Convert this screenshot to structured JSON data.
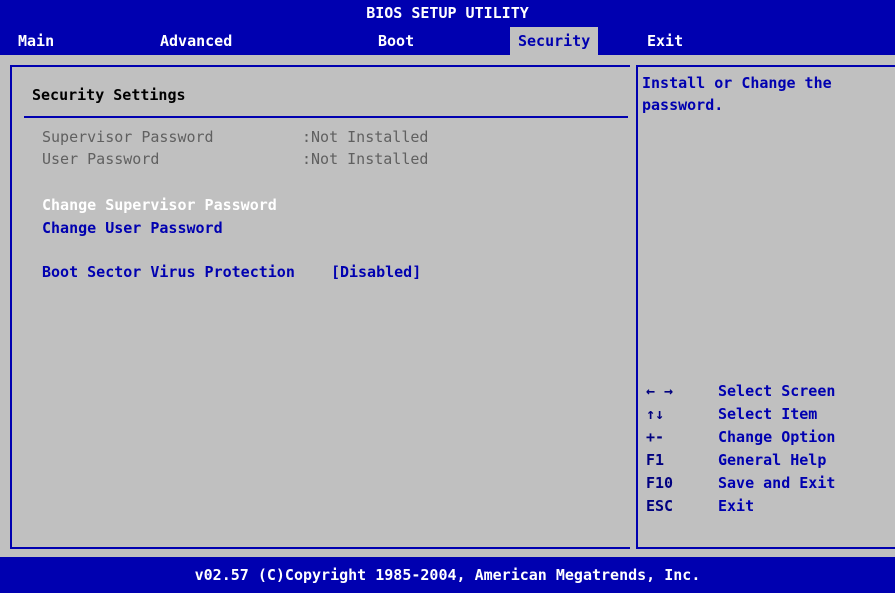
{
  "title": "BIOS SETUP UTILITY",
  "menu": {
    "main": "Main",
    "advanced": "Advanced",
    "boot": "Boot",
    "security": "Security",
    "exit": "Exit"
  },
  "section_title": "Security Settings",
  "info": [
    {
      "label": "Supervisor Password",
      "value": ":Not Installed"
    },
    {
      "label": "User Password",
      "value": ":Not Installed"
    }
  ],
  "items": {
    "change_supervisor": "Change Supervisor Password",
    "change_user": "Change User Password",
    "boot_sector_label": "Boot Sector Virus Protection",
    "boot_sector_value": "[Disabled]"
  },
  "help_text": "Install or Change the password.",
  "keys": [
    {
      "key": "← →",
      "desc": "Select Screen"
    },
    {
      "key": "↑↓",
      "desc": "Select Item"
    },
    {
      "key": "+-",
      "desc": "Change Option"
    },
    {
      "key": "F1",
      "desc": "General Help"
    },
    {
      "key": "F10",
      "desc": "Save and Exit"
    },
    {
      "key": "ESC",
      "desc": "Exit"
    }
  ],
  "footer": "v02.57 (C)Copyright 1985-2004, American Megatrends, Inc.",
  "colors": {
    "bar_blue": "#0000b0",
    "panel_gray": "#c0c0c0",
    "highlight": "#ffffff"
  }
}
